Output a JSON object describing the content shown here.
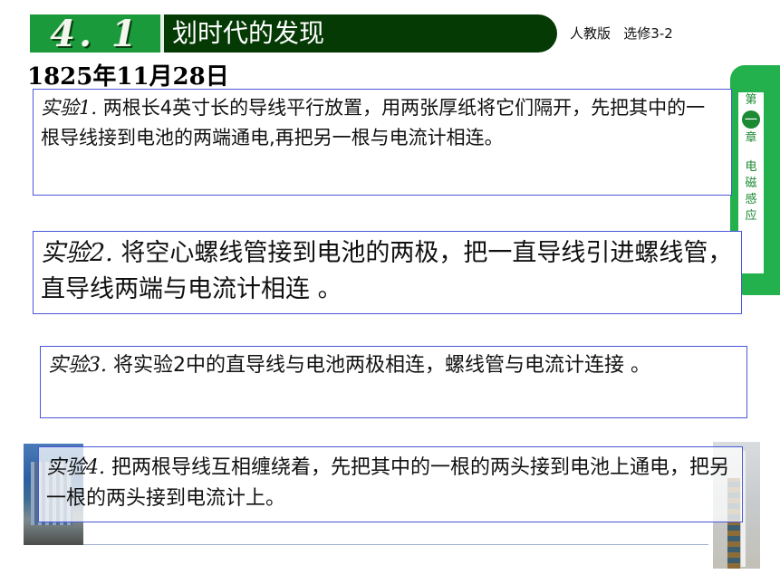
{
  "header": {
    "section_number": "4. 1",
    "title": "划时代的发现",
    "edition": "人教版   选修3-2"
  },
  "date": "1825年11月28日",
  "side_tab": {
    "chars_top": [
      "第"
    ],
    "chapter_number": "一",
    "chars_bottom": [
      "章"
    ],
    "chars_title": [
      "电",
      "磁",
      "感",
      "应"
    ]
  },
  "experiments": [
    {
      "label": "实验1.",
      "text": " 两根长4英寸长的导线平行放置，用两张厚纸将它们隔开，先把其中的一根导线接到电池的两端通电,再把另一根与电流计相连。"
    },
    {
      "label": "实验2.",
      "text": " 将空心螺线管接到电池的两极，把一直导线引进螺线管，直导线两端与电流计相连 。"
    },
    {
      "label": "实验3.",
      "text": " 将实验2中的直导线与电池两极相连，螺线管与电流计连接 。"
    },
    {
      "label": "实验4.",
      "text": " 把两根导线互相缠绕着，先把其中的一根的两头接到电池上通电，把另一根的两头接到电流计上。"
    }
  ]
}
